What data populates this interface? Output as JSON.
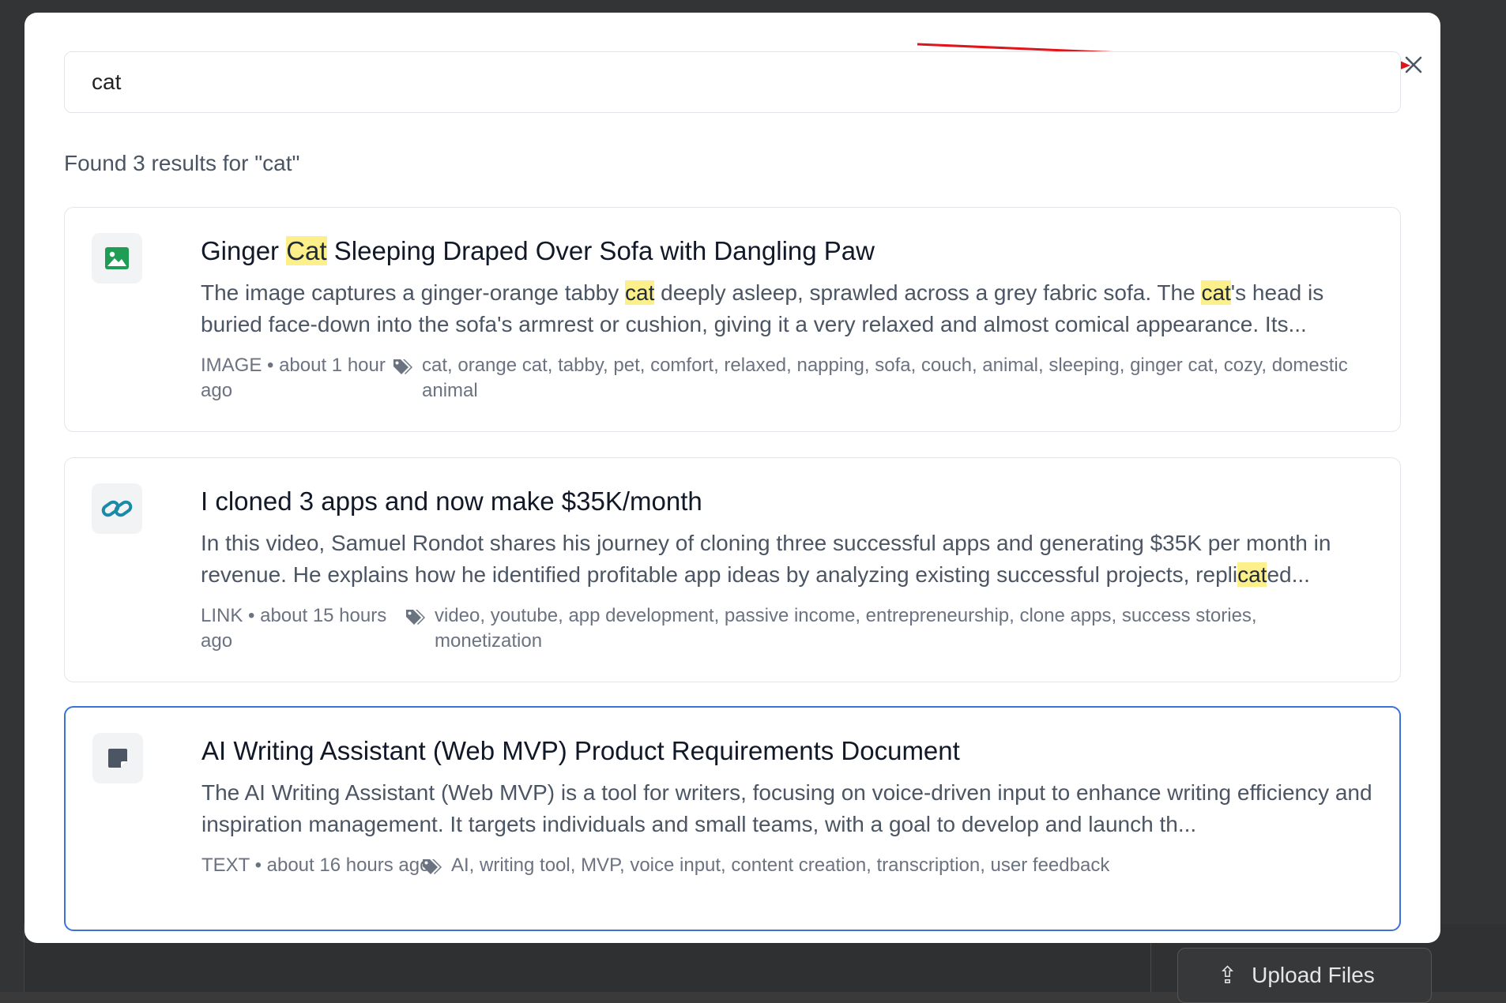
{
  "background": {
    "upload_button_label": "Upload Files"
  },
  "search": {
    "value": "cat",
    "query": "cat"
  },
  "results_text": "Found 3 results for \"cat\"",
  "colors": {
    "accent": "#3a72d8",
    "highlight": "#fdf08a",
    "image_icon": "#1f9d55",
    "link_icon": "#1a8aa8",
    "note_icon": "#4b5563",
    "annotation_arrow": "#e0141b"
  },
  "results": [
    {
      "type_icon": "image-icon",
      "title_parts": [
        "Ginger ",
        "Cat",
        " Sleeping Draped Over Sofa with Dangling Paw"
      ],
      "desc_parts": [
        "The image captures a ginger-orange tabby ",
        "cat",
        " deeply asleep, sprawled across a grey fabric sofa. The ",
        "cat",
        "'s head is buried face-down into the sofa's armrest or cushion, giving it a very relaxed and almost comical appearance. Its..."
      ],
      "meta": "IMAGE • about 1 hour ago",
      "tags": "cat, orange cat, tabby, pet, comfort, relaxed, napping, sofa, couch, animal, sleeping, ginger cat, cozy, domestic animal",
      "selected": false
    },
    {
      "type_icon": "link-icon",
      "title_parts": [
        "I cloned 3 apps and now make $35K/month"
      ],
      "desc_parts": [
        "In this video, Samuel Rondot shares his journey of cloning three successful apps and generating $35K per month in revenue. He explains how he identified profitable app ideas by analyzing existing successful projects, repli",
        "cat",
        "ed..."
      ],
      "meta": "LINK • about 15 hours ago",
      "tags": "video, youtube, app development, passive income, entrepreneurship, clone apps, success stories, monetization",
      "selected": false
    },
    {
      "type_icon": "note-icon",
      "title_parts": [
        "AI Writing Assistant (Web MVP) Product Requirements Document"
      ],
      "desc_parts": [
        "The AI Writing Assistant (Web MVP) is a tool for writers, focusing on voice-driven input to enhance writing efficiency and inspiration management. It targets individuals and small teams, with a goal to develop and launch th..."
      ],
      "meta": "TEXT • about 16 hours ago",
      "tags": "AI, writing tool, MVP, voice input, content creation, transcription, user feedback",
      "selected": true
    }
  ]
}
